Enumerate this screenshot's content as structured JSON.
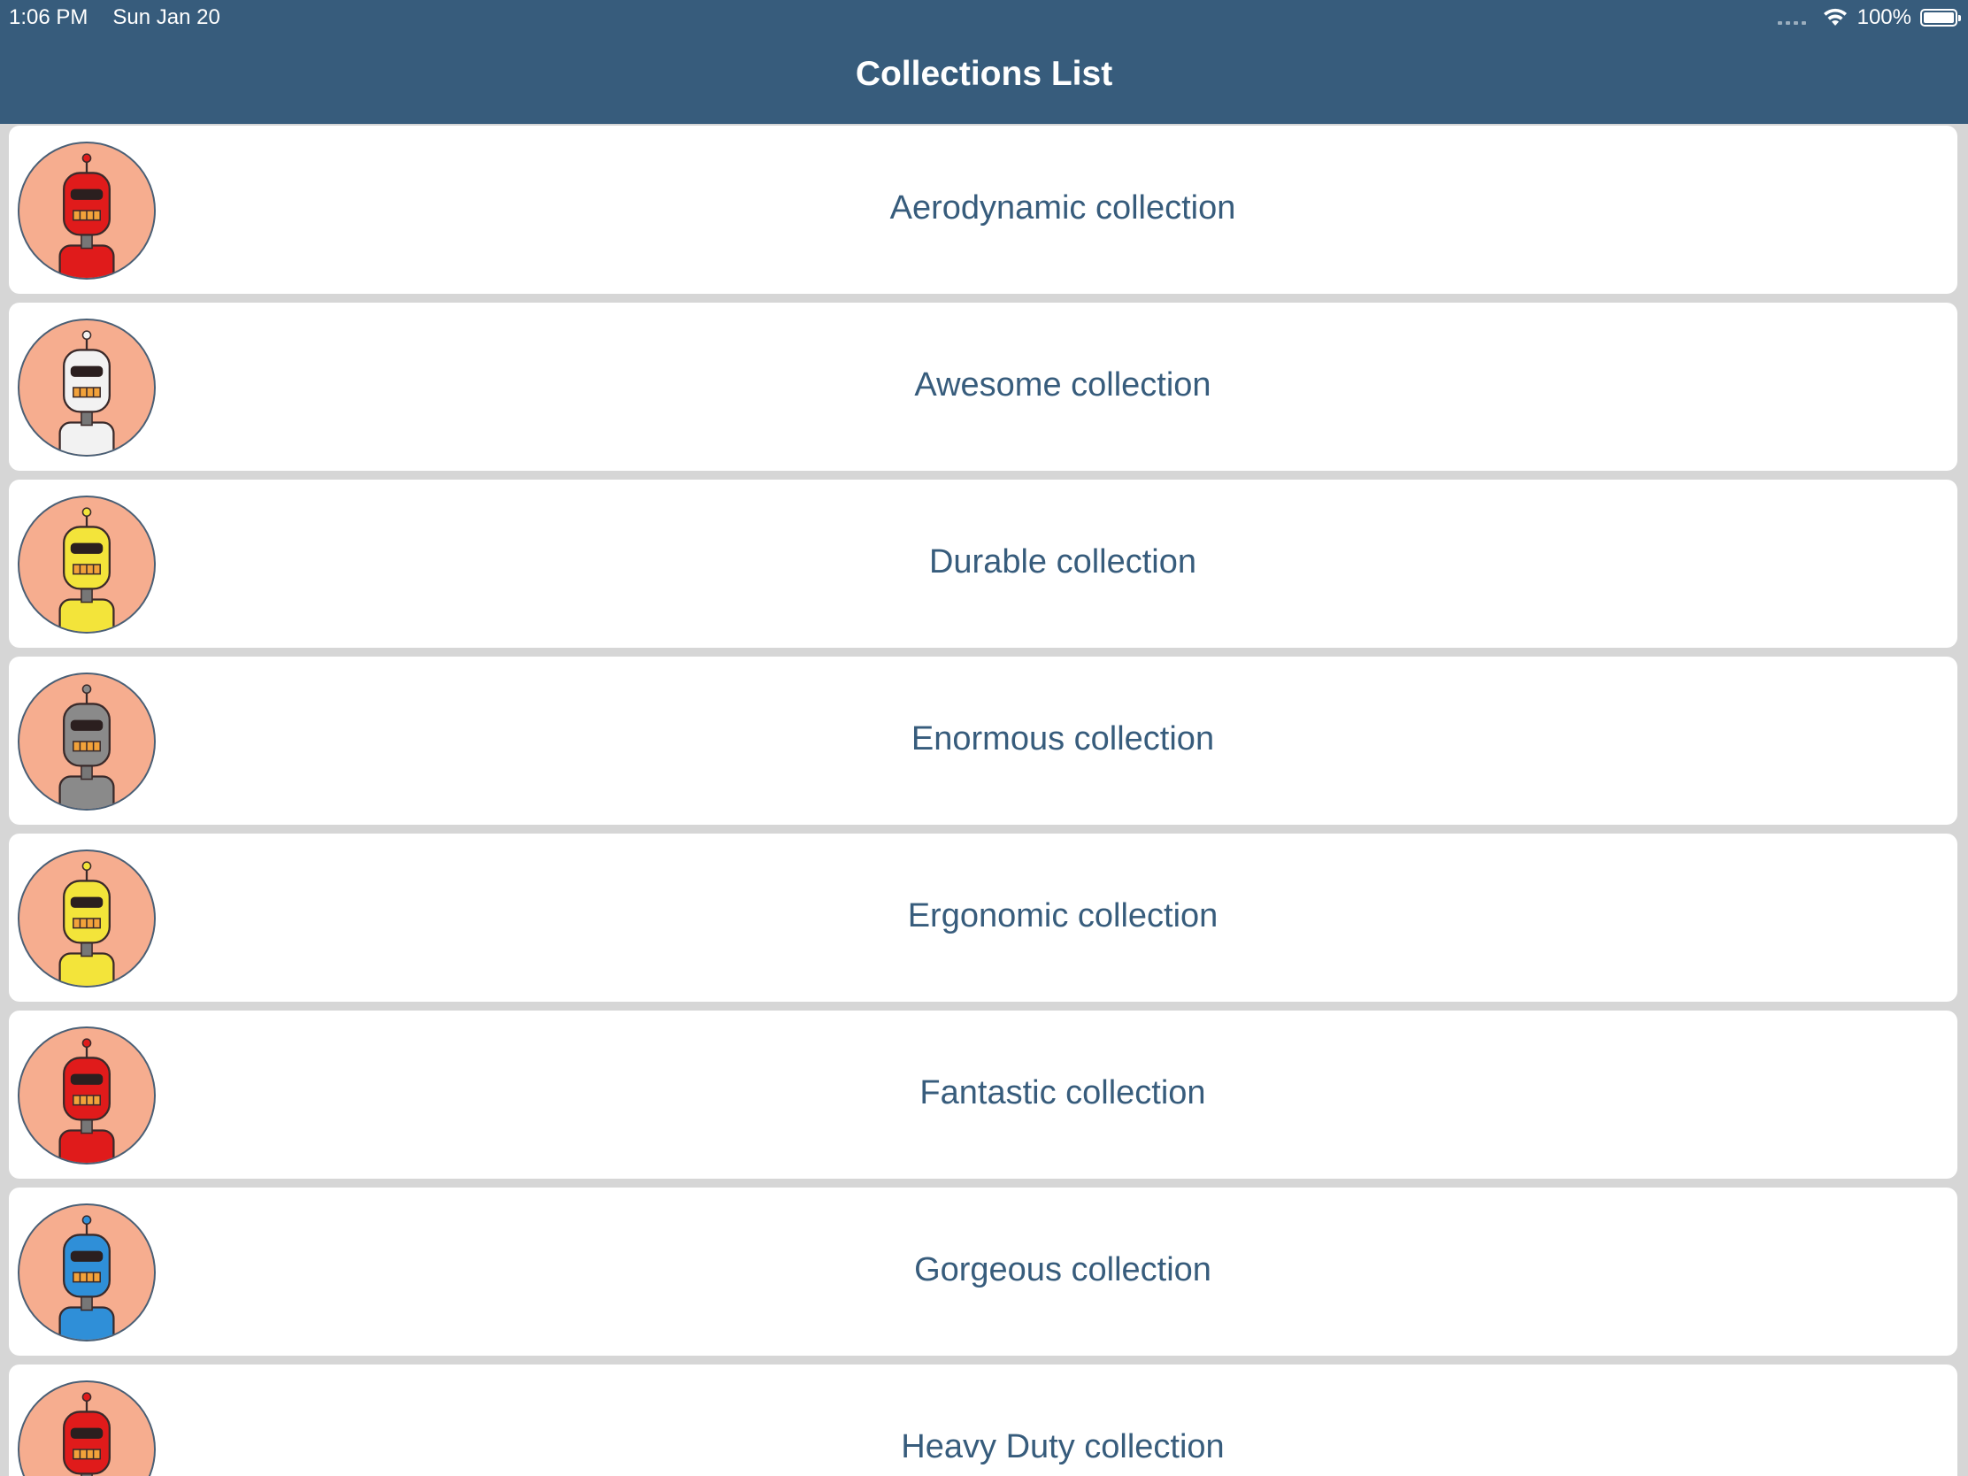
{
  "status_bar": {
    "time": "1:06 PM",
    "date": "Sun Jan 20",
    "battery_percent": "100%",
    "wifi_icon": "wifi-icon",
    "battery_icon": "battery-icon"
  },
  "header": {
    "title": "Collections List",
    "background": "#375c7c"
  },
  "colors": {
    "avatar_bg": "#f6ad8f",
    "label_text": "#375c7c"
  },
  "collections": [
    {
      "label": "Aerodynamic collection",
      "robot_color": "#e01b1b",
      "icon": "red-robot-avatar"
    },
    {
      "label": "Awesome collection",
      "robot_color": "#f2f2f2",
      "icon": "white-robot-avatar"
    },
    {
      "label": "Durable collection",
      "robot_color": "#f3e43a",
      "icon": "yellow-robot-avatar"
    },
    {
      "label": "Enormous collection",
      "robot_color": "#8a8a8a",
      "icon": "gray-robot-avatar"
    },
    {
      "label": "Ergonomic collection",
      "robot_color": "#f3e43a",
      "icon": "yellow-robot-avatar"
    },
    {
      "label": "Fantastic collection",
      "robot_color": "#e01b1b",
      "icon": "red-robot-avatar"
    },
    {
      "label": "Gorgeous collection",
      "robot_color": "#2f8fd8",
      "icon": "blue-robot-avatar"
    },
    {
      "label": "Heavy Duty collection",
      "robot_color": "#e01b1b",
      "icon": "red-robot-avatar"
    }
  ]
}
